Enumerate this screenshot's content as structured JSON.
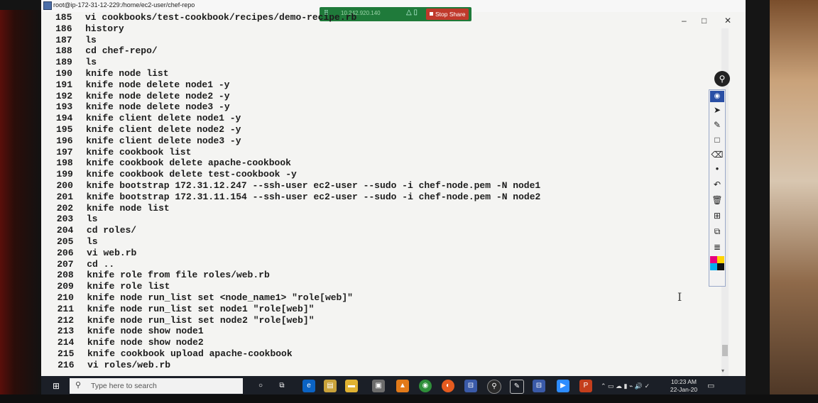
{
  "window": {
    "title": "root@ip-172-31-12-229:/home/ec2-user/chef-repo",
    "controls": {
      "minimize": "–",
      "maximize": "□",
      "close": "✕"
    }
  },
  "share_bar": {
    "ip": "10.242.920.140",
    "stop_label": "Stop Share"
  },
  "terminal": {
    "lines": [
      {
        "n": "185",
        "cmd": "vi cookbooks/test-cookbook/recipes/demo-recipe.rb"
      },
      {
        "n": "186",
        "cmd": "history"
      },
      {
        "n": "187",
        "cmd": "ls"
      },
      {
        "n": "188",
        "cmd": "cd chef-repo/"
      },
      {
        "n": "189",
        "cmd": "ls"
      },
      {
        "n": "190",
        "cmd": "knife node list"
      },
      {
        "n": "191",
        "cmd": "knife node delete node1 -y"
      },
      {
        "n": "192",
        "cmd": "knife node delete node2 -y"
      },
      {
        "n": "193",
        "cmd": "knife node delete node3 -y"
      },
      {
        "n": "194",
        "cmd": "knife client delete node1 -y"
      },
      {
        "n": "195",
        "cmd": "knife client delete node2 -y"
      },
      {
        "n": "196",
        "cmd": "knife client delete node3 -y"
      },
      {
        "n": "197",
        "cmd": "knife cookbook list"
      },
      {
        "n": "198",
        "cmd": "knife cookbook delete apache-cookbook"
      },
      {
        "n": "199",
        "cmd": "knife cookbook delete test-cookbook -y"
      },
      {
        "n": "200",
        "cmd": "knife bootstrap 172.31.12.247 --ssh-user ec2-user --sudo -i chef-node.pem -N node1"
      },
      {
        "n": "201",
        "cmd": "knife bootstrap 172.31.11.154 --ssh-user ec2-user --sudo -i chef-node.pem -N node2"
      },
      {
        "n": "202",
        "cmd": "knife node list"
      },
      {
        "n": "203",
        "cmd": "ls"
      },
      {
        "n": "204",
        "cmd": "cd roles/"
      },
      {
        "n": "205",
        "cmd": "ls"
      },
      {
        "n": "206",
        "cmd": "vi web.rb"
      },
      {
        "n": "207",
        "cmd": "cd .."
      },
      {
        "n": "208",
        "cmd": "knife role from file roles/web.rb"
      },
      {
        "n": "209",
        "cmd": "knife role list"
      },
      {
        "n": "210",
        "cmd": "knife node run_list set <node_name1> \"role[web]\""
      },
      {
        "n": "211",
        "cmd": "knife node run_list set node1 \"role[web]\""
      },
      {
        "n": "212",
        "cmd": "knife node run_list set node2 \"role[web]\""
      },
      {
        "n": "213",
        "cmd": "knife node show node1"
      },
      {
        "n": "214",
        "cmd": "knife node show node2"
      },
      {
        "n": "215",
        "cmd": "knife cookbook upload apache-cookbook"
      },
      {
        "n": "216",
        "cmd": "vi roles/web.rb"
      }
    ]
  },
  "toolbar_icons": [
    "map-pin-icon",
    "eye-icon",
    "pointer-icon",
    "pen-icon",
    "rectangle-icon",
    "eraser-icon",
    "dot-icon",
    "undo-icon",
    "trash-icon",
    "clear-all-icon",
    "screenshot-icon",
    "notes-icon"
  ],
  "palette_colors": [
    "#e6007e",
    "#ffd400",
    "#00aeef",
    "#111111"
  ],
  "taskbar": {
    "search_placeholder": "Type here to search",
    "clock_time": "10:23 AM",
    "clock_date": "22-Jan-20"
  }
}
